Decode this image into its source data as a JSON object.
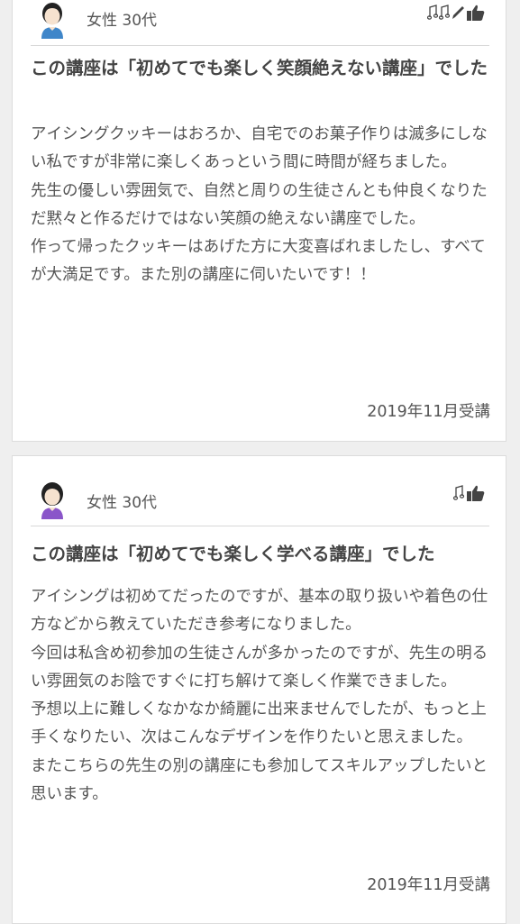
{
  "reviews": [
    {
      "reviewer": "女性 30代",
      "title": "この講座は「初めてでも楽しく笑顔絶えない講座」でした",
      "body": "アイシングクッキーはおろか、自宅でのお菓子作りは滅多にしない私ですが非常に楽しくあっという間に時間が経ちました。\n先生の優しい雰囲気で、自然と周りの生徒さんとも仲良くなりただ黙々と作るだけではない笑顔の絶えない講座でした。\n作って帰ったクッキーはあげた方に大変喜ばれましたし、すべてが大満足です。また別の講座に伺いたいです！！",
      "date": "2019年11月受講",
      "icons": [
        "music-note-icon",
        "music-note-icon",
        "pencil-icon",
        "thumbs-up-icon"
      ]
    },
    {
      "reviewer": "女性 30代",
      "title": "この講座は「初めてでも楽しく学べる講座」でした",
      "body": "アイシングは初めてだったのですが、基本の取り扱いや着色の仕方などから教えていただき参考になりました。\n今回は私含め初参加の生徒さんが多かったのですが、先生の明るい雰囲気のお陰ですぐに打ち解けて楽しく作業できました。\n予想以上に難しくなかなか綺麗に出来ませんでしたが、もっと上手くなりたい、次はこんなデザインを作りたいと思えました。\nまたこちらの先生の別の講座にも参加してスキルアップしたいと思います。",
      "date": "2019年11月受講",
      "icons": [
        "music-note-icon",
        "thumbs-up-icon"
      ]
    }
  ]
}
